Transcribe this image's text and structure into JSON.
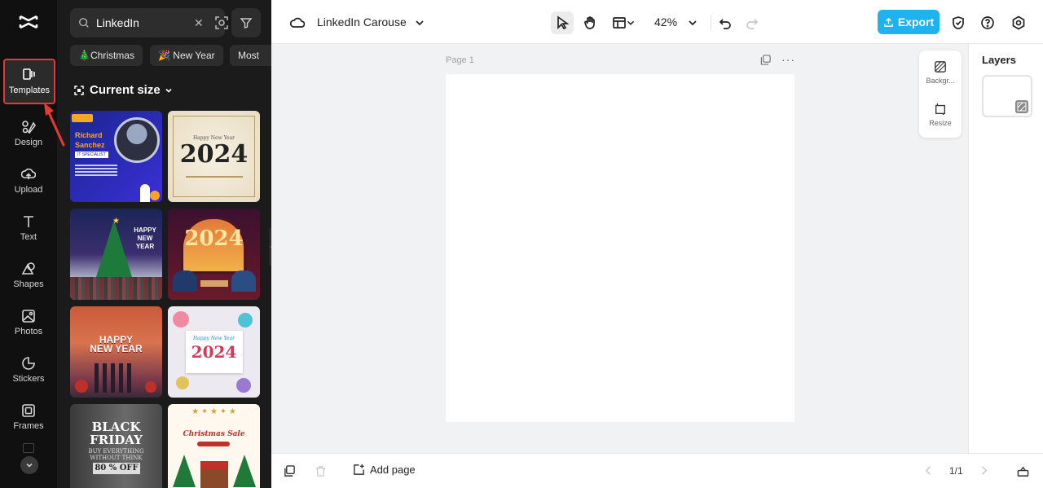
{
  "rail": {
    "items": [
      {
        "label": "Templates"
      },
      {
        "label": "Design"
      },
      {
        "label": "Upload"
      },
      {
        "label": "Text"
      },
      {
        "label": "Shapes"
      },
      {
        "label": "Photos"
      },
      {
        "label": "Stickers"
      },
      {
        "label": "Frames"
      }
    ]
  },
  "panel": {
    "search_value": "LinkedIn",
    "chips": [
      "🎄Christmas",
      "🎉 New Year",
      "Most"
    ],
    "size_label": "Current size"
  },
  "thumbs": [
    {
      "name": "Richard Sanchez",
      "sub": "IT SPECIALIST",
      "colors": [
        "#1f2a8f",
        "#3a2fd0"
      ]
    },
    {
      "line1": "Happy New Year",
      "big": "2024"
    },
    {
      "line1": "HAPPY",
      "line2": "NEW",
      "line3": "YEAR"
    },
    {
      "big": "2024"
    },
    {
      "line1": "HAPPY",
      "line2": "NEW YEAR"
    },
    {
      "line1": "Happy New Year",
      "big": "2024"
    },
    {
      "line1": "BLACK",
      "line2": "FRIDAY",
      "line3": "BUY EVERYTHING WITHOUT THINK",
      "line4": "80 % OFF"
    },
    {
      "line1": "Christmas Sale"
    }
  ],
  "topbar": {
    "doc_title": "LinkedIn Carouse",
    "zoom": "42%",
    "export_label": "Export"
  },
  "canvas": {
    "page_label": "Page 1",
    "tools": [
      {
        "label": "Backgr..."
      },
      {
        "label": "Resize"
      }
    ]
  },
  "layers": {
    "title": "Layers"
  },
  "bottombar": {
    "add_page": "Add page",
    "page_count": "1/1"
  }
}
